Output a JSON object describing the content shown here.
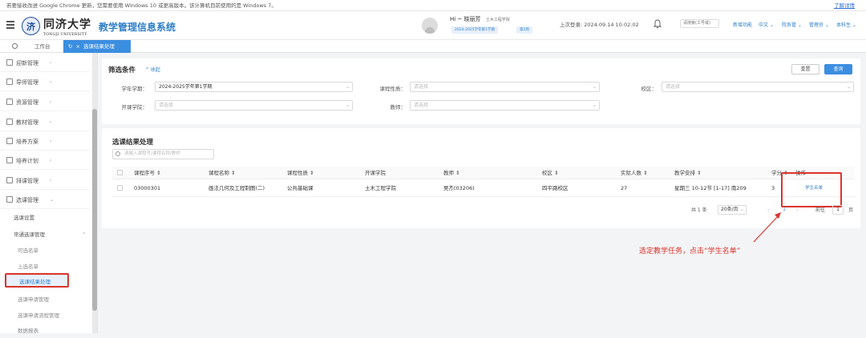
{
  "browser_banner": {
    "text": "若要接收改进 Google Chrome 更新，您需要使用 Windows 10 或更高版本。该计算机目前使用的是 Windows 7。",
    "link": "了解详情"
  },
  "header": {
    "school_cn": "同济大学",
    "school_en": "TONGJI UNIVERSITY",
    "system_title": "教学管理信息系统",
    "greeting": "Hi ~ 晓丽芳",
    "org": "土木工程学院",
    "term_chip": "2024-2025学年第1学期",
    "week_chip": "第2周",
    "last_login": "上次登录: 2024.09.14 10:02:02",
    "account_placeholder": "请搜索(工号或)",
    "items": [
      "新增功能",
      "中文 ⌄",
      "院系管 ⌄",
      "管理员 ⌄",
      "本科生 ⌄"
    ]
  },
  "tabs": {
    "workbench": "工作台",
    "active": "选课结果处理"
  },
  "sidebar": {
    "items": [
      {
        "label": "迎新管理",
        "icon": "welcome-icon"
      },
      {
        "label": "导师管理",
        "icon": "mentor-icon"
      },
      {
        "label": "资源管理",
        "icon": "resource-icon"
      },
      {
        "label": "教材管理",
        "icon": "textbook-icon"
      },
      {
        "label": "培养方案",
        "icon": "program-icon"
      },
      {
        "label": "培养计划",
        "icon": "plan-icon"
      },
      {
        "label": "排课管理",
        "icon": "schedule-icon"
      },
      {
        "label": "选课管理",
        "icon": "selection-icon"
      }
    ],
    "subitems": [
      "选课设置",
      "常通选课管理"
    ],
    "subsubitems": [
      "可选名单",
      "上选名单",
      "选课结果处理",
      "选课申请管理",
      "选课申请流程管理",
      "数据报表"
    ]
  },
  "filter": {
    "title": "筛选条件",
    "collapse": "^ 收起",
    "reset": "重置",
    "query": "查询",
    "term_label": "学年学期：",
    "term_value": "2024-2025学年第1学期",
    "course_nature_label": "课程性质：",
    "course_nature_ph": "请选择",
    "campus_label": "校区：",
    "campus_ph": "请选择",
    "college_label": "开课学院：",
    "college_ph": "请选择",
    "teacher_label": "教师：",
    "teacher_ph": "请选择"
  },
  "results": {
    "title": "选课结果处理",
    "search_ph": "请输入课程号/课程名称/教师",
    "columns": [
      "课程序号 ⇕",
      "课程名称 ⇕",
      "课程性质 ⇕",
      "开课学院",
      "教师 ⇕",
      "校区 ⇕",
      "实际人数 ⇕",
      "教学安排 ⇕",
      "学分 ⇕",
      "操作"
    ],
    "rows": [
      {
        "code": "03000301",
        "name": "画法几何及工程制图(二)",
        "nature": "公共基础课",
        "college": "土木工程学院",
        "teacher": "吴杰(03206)",
        "campus": "四平路校区",
        "count": "27",
        "schedule": "星期三 10-12节 [1-17] 南209",
        "credit": "3",
        "action": "学生名单"
      }
    ],
    "pager": {
      "total": "共 1 条",
      "page_size": "20条/页",
      "prev": "‹",
      "page": "1",
      "next": "›",
      "goto": "前往",
      "goto_value": "1",
      "page_unit": "页"
    }
  },
  "annotation": "选定教学任务，点击“学生名单”"
}
